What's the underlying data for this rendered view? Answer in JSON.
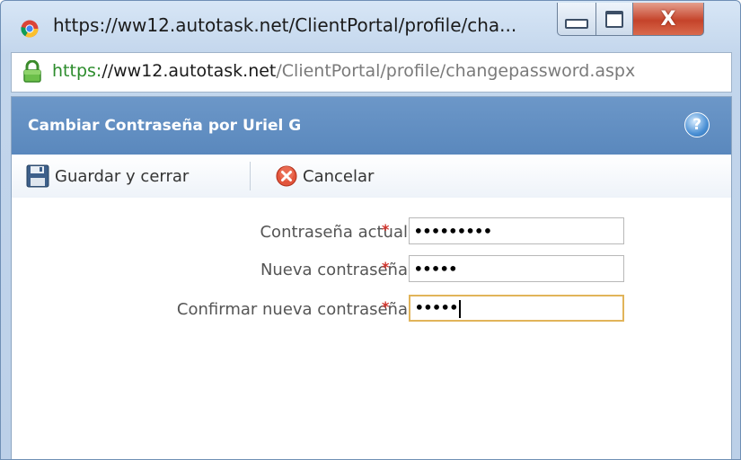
{
  "window": {
    "title": "https://ww12.autotask.net/ClientPortal/profile/cha...",
    "controls": {
      "minimize": "minimize",
      "maximize": "maximize",
      "close": "X"
    }
  },
  "addressbar": {
    "scheme": "https:",
    "host": "//ww12.autotask.net",
    "path": "/ClientPortal/profile/changepassword.aspx"
  },
  "panel": {
    "title": "Cambiar Contraseña por Uriel G",
    "help_label": "?"
  },
  "toolbar": {
    "save_label": "Guardar y cerrar",
    "cancel_label": "Cancelar"
  },
  "form": {
    "required_marker": "*",
    "fields": [
      {
        "label": "Contraseña actual",
        "masked_value": "•••••••••",
        "focused": false
      },
      {
        "label": "Nueva contraseña",
        "masked_value": "•••••",
        "focused": false
      },
      {
        "label": "Confirmar nueva contraseña",
        "masked_value": "•••••",
        "focused": true
      }
    ]
  },
  "colors": {
    "header_blue": "#5a88bd",
    "required_red": "#d0332b",
    "focus_border": "#e1b45a",
    "secure_green": "#2c8c2c"
  },
  "icons": {
    "browser": "chrome-logo-icon",
    "lock": "padlock-icon",
    "help": "help-icon",
    "save": "floppy-disk-icon",
    "cancel": "cancel-x-icon"
  }
}
